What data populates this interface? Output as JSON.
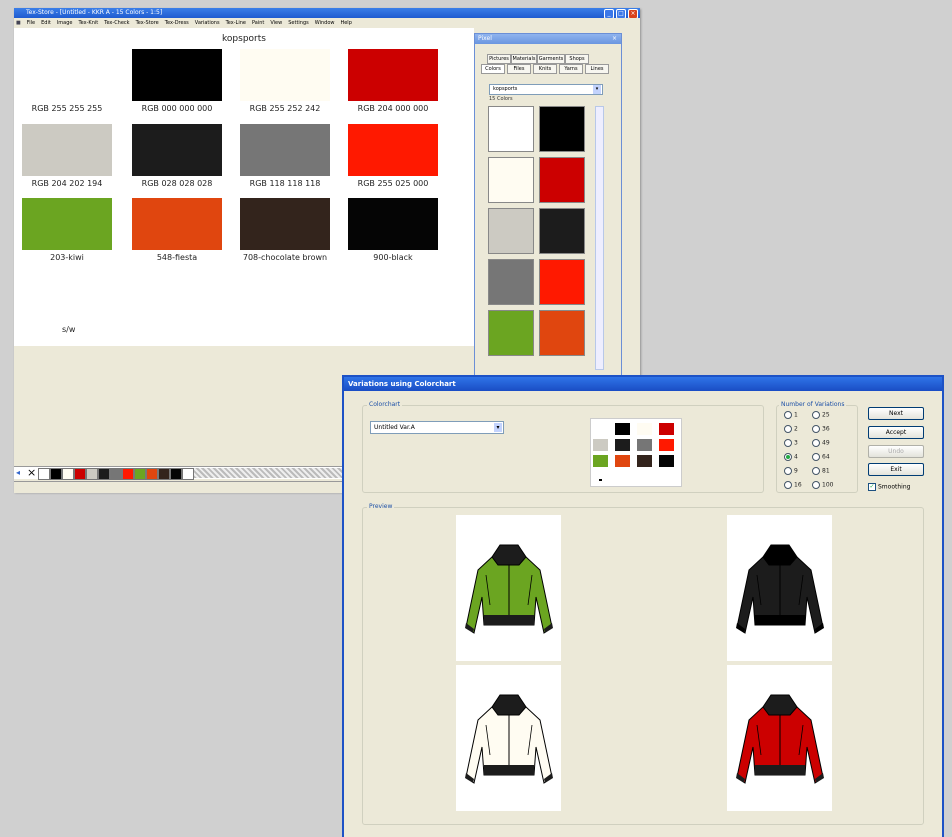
{
  "main_window": {
    "title": "Tex-Store - [Untitled - KKR A - 15 Colors - 1:5]",
    "menu": [
      "File",
      "Edit",
      "Image",
      "Tex-Knit",
      "Tex-Check",
      "Tex-Store",
      "Tex-Dress",
      "Variations",
      "Tex-Line",
      "Paint",
      "View",
      "Settings",
      "Window",
      "Help"
    ],
    "chart_title": "kopsports",
    "swatches": [
      {
        "label": "RGB 255 255 255",
        "color": "#ffffff"
      },
      {
        "label": "RGB 000 000 000",
        "color": "#000000"
      },
      {
        "label": "RGB 255 252 242",
        "color": "#fffcf2"
      },
      {
        "label": "RGB 204 000 000",
        "color": "#cc0000"
      },
      {
        "label": "RGB 204 202 194",
        "color": "#cccac2"
      },
      {
        "label": "RGB 028 028 028",
        "color": "#1c1c1c"
      },
      {
        "label": "RGB 118 118 118",
        "color": "#767676"
      },
      {
        "label": "RGB 255 025 000",
        "color": "#ff1900"
      },
      {
        "label": "203-kiwi",
        "color": "#6ba521"
      },
      {
        "label": "548-fiesta",
        "color": "#e0460f"
      },
      {
        "label": "708-chocolate brown",
        "color": "#33241c"
      },
      {
        "label": "900-black",
        "color": "#050505"
      }
    ],
    "sw_label": "s/w"
  },
  "pixel_panel": {
    "title": "Pixel",
    "tabs_row1": [
      "Pictures",
      "Materials",
      "Garments",
      "Shops"
    ],
    "tabs_row2": [
      "Colors",
      "Files",
      "Knits",
      "Yarns",
      "Lines"
    ],
    "dropdown": "kopsports",
    "count": "15 Colors",
    "cells": [
      "#ffffff",
      "#000000",
      "#fffcf2",
      "#cc0000",
      "#cccac2",
      "#1c1c1c",
      "#767676",
      "#ff1900",
      "#6ba521",
      "#e0460f"
    ]
  },
  "dialog": {
    "title": "Variations using Colorchart",
    "colorchart_label": "Colorchart",
    "colorchart_value": "Untitled Var.A",
    "num_variations_label": "Number of Variations",
    "options": [
      "1",
      "2",
      "3",
      "4",
      "9",
      "16",
      "25",
      "36",
      "49",
      "64",
      "81",
      "100"
    ],
    "selected": "4",
    "buttons": {
      "next": "Next",
      "accept": "Accept",
      "undo": "Undo",
      "exit": "Exit"
    },
    "smoothing": "Smoothing",
    "preview_label": "Preview",
    "jackets": [
      {
        "name": "green",
        "body": "#6ba521",
        "trim": "#1c1c1c"
      },
      {
        "name": "black",
        "body": "#1c1c1c",
        "trim": "#000000"
      },
      {
        "name": "white",
        "body": "#fffcf2",
        "trim": "#1c1c1c"
      },
      {
        "name": "red",
        "body": "#cc0000",
        "trim": "#1c1c1c"
      }
    ]
  },
  "palette_bar": [
    "#ffffff",
    "#000000",
    "#fffcf2",
    "#cc0000",
    "#cccac2",
    "#1c1c1c",
    "#767676",
    "#ff1900",
    "#6ba521",
    "#e0460f",
    "#33241c",
    "#050505",
    "#ffffff"
  ]
}
